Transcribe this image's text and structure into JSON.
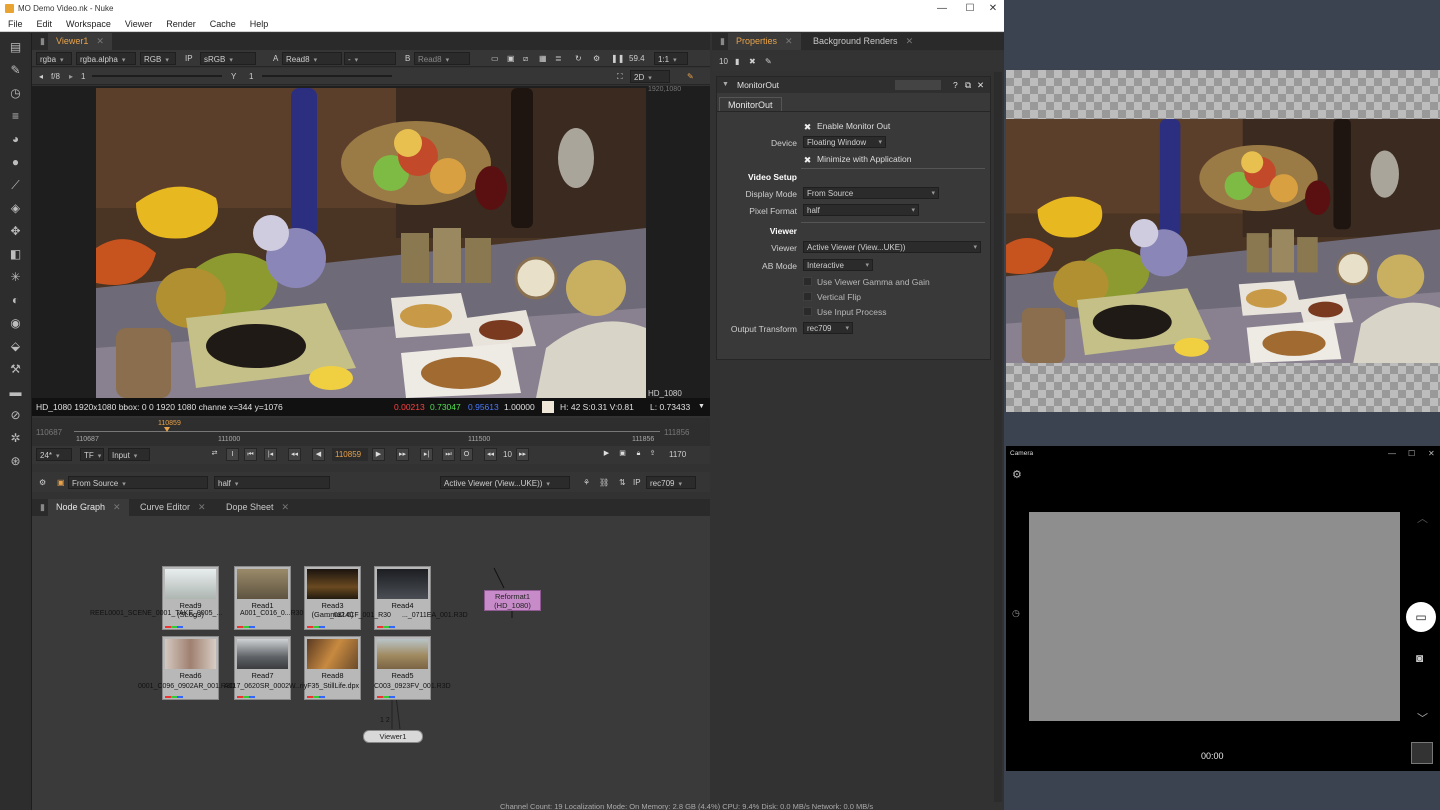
{
  "window": {
    "title": "MO Demo Video.nk - Nuke",
    "minimize": "—",
    "maximize": "☐",
    "close": "✕"
  },
  "menu": [
    "File",
    "Edit",
    "Workspace",
    "Viewer",
    "Render",
    "Cache",
    "Help"
  ],
  "viewer": {
    "tab_label": "Viewer1",
    "row1": {
      "channels": "rgba",
      "alpha": "rgba.alpha",
      "colorspace": "RGB",
      "ip": "IP",
      "lut": "sRGB",
      "a_label": "A",
      "a_input": "Read8",
      "dash": "-",
      "b_label": "B",
      "b_input": "Read8",
      "gain": "59.4",
      "zoom": "1:1"
    },
    "row2": {
      "fstop": "f/8",
      "gain_value": "1",
      "y_label": "Y",
      "gamma_value": "1",
      "view_mode": "2D"
    },
    "format_label": "HD_1080",
    "format_label_top": "1920,1080",
    "info": {
      "format": "HD_1080 1920x1080  bbox: 0 0 1920 1080 channe  x=344 y=1076",
      "r": "0.00213",
      "g": "0.73047",
      "b": "0.95613",
      "a": "1.00000",
      "hsv": "H: 42 S:0.31 V:0.81",
      "l": "L: 0.73433"
    }
  },
  "timeline": {
    "start": "110687",
    "end": "111856",
    "current": "110859",
    "ticks": [
      "110687",
      "111000",
      "111500",
      "111856"
    ]
  },
  "transport": {
    "fps": "24*",
    "tf": "TF",
    "input": "Input",
    "frame": "110859",
    "step": "10",
    "count": "1170"
  },
  "monitor_row": {
    "source": "From Source",
    "pixel": "half",
    "viewer": "Active Viewer (View...UKE))",
    "ip": "IP",
    "transform": "rec709"
  },
  "panels": {
    "node_graph": "Node Graph",
    "curve_editor": "Curve Editor",
    "dope_sheet": "Dope Sheet"
  },
  "nodes": [
    {
      "name": "Read9",
      "sub": "(SLog3)",
      "file": "REEL0001_SCENE_0001_TAKE_0005_...",
      "color": "#cfd6d6"
    },
    {
      "name": "Read1",
      "sub": "",
      "file": "A001_C016_0...R30",
      "color": "#7a6e58"
    },
    {
      "name": "Read3",
      "sub": "(Gamma2.6)",
      "file": "..._0314CF_001_R30",
      "color": "#3b2c1c"
    },
    {
      "name": "Read4",
      "sub": "",
      "file": "..._0711EA_001.R3D",
      "color": "#2e3236"
    },
    {
      "name": "Read6",
      "sub": "",
      "file": "0001_C096_0902AR_001.R3D",
      "color": "#b69a88"
    },
    {
      "name": "Read7",
      "sub": "",
      "file": "A017_0620SR_0002W",
      "color": "#6f7478"
    },
    {
      "name": "Read8",
      "sub": "",
      "file": "...riyF35_StillLife.dpx",
      "color": "#7e5a36"
    },
    {
      "name": "Read5",
      "sub": "",
      "file": "C003_0923FV_001.R3D",
      "color": "#a49170"
    }
  ],
  "reformat": {
    "name": "Reformat1",
    "sub": "(HD_1080)"
  },
  "viewer_node": {
    "name": "Viewer1",
    "inputs": "1  2"
  },
  "status_bar": "Channel Count: 19  Localization Mode: On  Memory: 2.8 GB (4.4%)  CPU: 9.4%  Disk: 0.0 MB/s  Network: 0.0 MB/s",
  "properties": {
    "tab": "Properties",
    "tab2": "Background Renders",
    "count": "10",
    "node_name": "MonitorOut",
    "node_tab": "MonitorOut",
    "enable_monitor_out": "Enable Monitor Out",
    "device_label": "Device",
    "device_value": "Floating Window",
    "minimize_with_app": "Minimize with Application",
    "video_setup": "Video Setup",
    "display_mode_label": "Display Mode",
    "display_mode_value": "From Source",
    "pixel_format_label": "Pixel Format",
    "pixel_format_value": "half",
    "viewer_section": "Viewer",
    "viewer_label": "Viewer",
    "viewer_value": "Active Viewer (View...UKE))",
    "ab_mode_label": "AB Mode",
    "ab_mode_value": "Interactive",
    "use_gamma_gain": "Use Viewer Gamma and Gain",
    "vertical_flip": "Vertical Flip",
    "use_input_process": "Use Input Process",
    "output_transform_label": "Output Transform",
    "output_transform_value": "rec709"
  },
  "camera": {
    "title": "Camera",
    "time": "00:00"
  },
  "colors": {
    "accent_orange": "#e8a24a",
    "reformat_node": "#c68bc8"
  }
}
